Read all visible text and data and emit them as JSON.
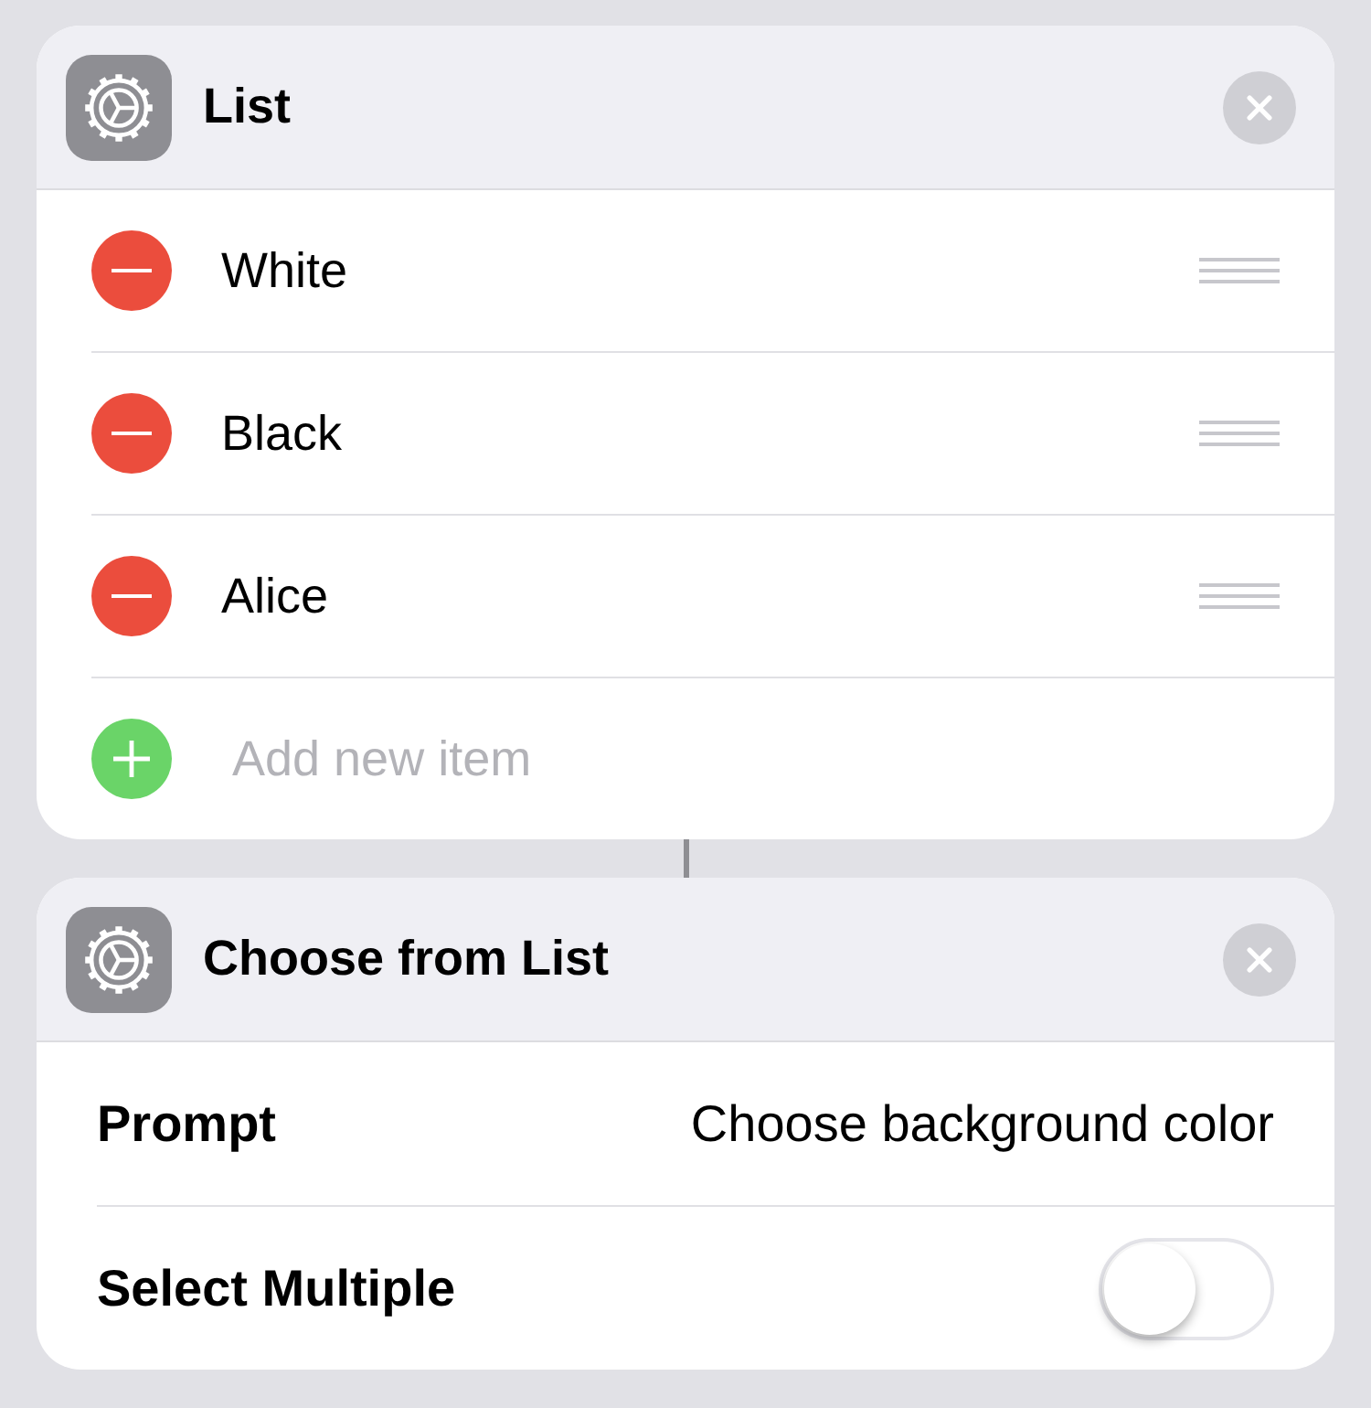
{
  "cards": [
    {
      "kind": "list",
      "title": "List",
      "items": [
        {
          "label": "White"
        },
        {
          "label": "Black"
        },
        {
          "label": "Alice"
        }
      ],
      "add_item": {
        "placeholder": "Add new item"
      }
    },
    {
      "kind": "action",
      "title": "Choose from List",
      "params": [
        {
          "kind": "text",
          "label": "Prompt",
          "value": "Choose background color"
        },
        {
          "kind": "toggle",
          "label": "Select Multiple",
          "on": false
        }
      ]
    }
  ]
}
